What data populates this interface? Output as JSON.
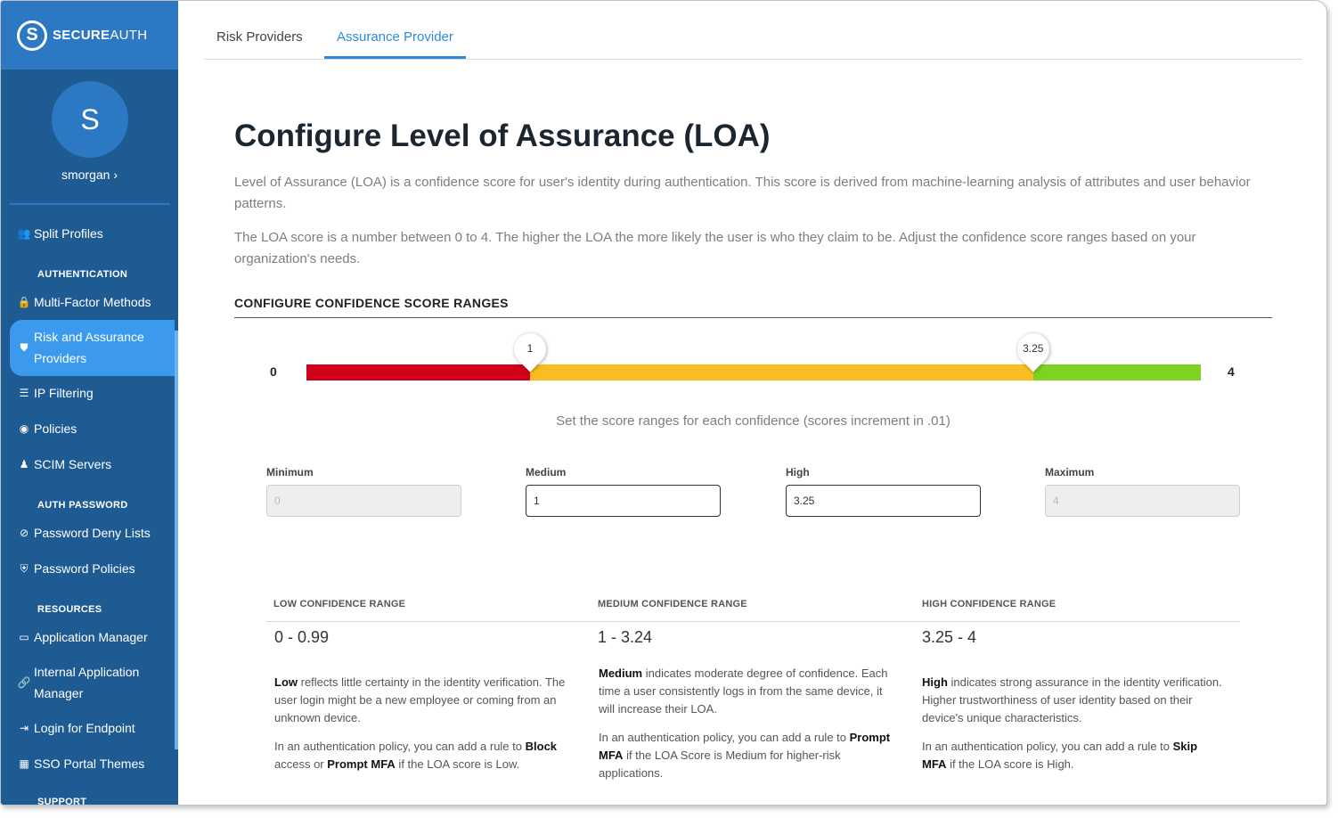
{
  "brand": {
    "logo_letter": "S",
    "name_bold": "SECURE",
    "name_light": "AUTH"
  },
  "user": {
    "initial": "S",
    "name": "smorgan ›"
  },
  "nav": {
    "split_profiles": "Split Profiles",
    "section_auth": "AUTHENTICATION",
    "mfa": "Multi-Factor Methods",
    "risk_line1": "Risk and Assurance",
    "risk_line2": "Providers",
    "ip": "IP Filtering",
    "policies": "Policies",
    "scim": "SCIM Servers",
    "section_password": "AUTH PASSWORD",
    "deny_lists": "Password Deny Lists",
    "pw_policies": "Password Policies",
    "section_resources": "RESOURCES",
    "app_manager": "Application Manager",
    "internal_line1": "Internal Application",
    "internal_line2": "Manager",
    "login_endpoint": "Login for Endpoint",
    "sso_themes": "SSO Portal Themes",
    "section_support": "SUPPORT"
  },
  "tabs": {
    "risk": "Risk Providers",
    "assurance": "Assurance Provider"
  },
  "page": {
    "title": "Configure Level of Assurance (LOA)",
    "desc1": "Level of Assurance (LOA) is a confidence score for user's identity during authentication. This score is derived from machine-learning analysis of attributes and user behavior patterns.",
    "desc2": "The LOA score is a number between 0 to 4. The higher the LOA the more likely the user is who they claim to be. Adjust the confidence score ranges based on your organization's needs.",
    "section_title": "CONFIGURE CONFIDENCE SCORE RANGES",
    "hint": "Set the score ranges for each confidence (scores increment in .01)"
  },
  "slider": {
    "min_label": "0",
    "max_label": "4",
    "medium_marker": "1",
    "high_marker": "3.25",
    "min": 0,
    "max": 4,
    "medium": 1,
    "high": 3.25,
    "colors": {
      "low": "#d0021b",
      "medium": "#f9bd22",
      "high": "#7ed321"
    }
  },
  "fields": {
    "minimum_label": "Minimum",
    "minimum_value": "0",
    "medium_label": "Medium",
    "medium_value": "1",
    "high_label": "High",
    "high_value": "3.25",
    "maximum_label": "Maximum",
    "maximum_value": "4"
  },
  "ranges": {
    "low": {
      "heading": "LOW CONFIDENCE RANGE",
      "value": "0 - 0.99",
      "p1_bold": "Low",
      "p1_rest": " reflects little certainty in the identity verification. The user login might be a new employee or coming from an unknown device.",
      "p2_a": "In an authentication policy, you can add a rule to ",
      "p2_b1": "Block",
      "p2_c": " access or ",
      "p2_b2": "Prompt MFA",
      "p2_d": " if the LOA score is Low."
    },
    "medium": {
      "heading": "MEDIUM CONFIDENCE RANGE",
      "value": "1 - 3.24",
      "p1_bold": "Medium",
      "p1_rest": " indicates moderate degree of confidence. Each time a user consistently logs in from the same device, it will increase their LOA.",
      "p2_a": "In an authentication policy, you can add a rule to ",
      "p2_b1": "Prompt MFA",
      "p2_c": " if the LOA Score is Medium for higher-risk applications."
    },
    "high": {
      "heading": "HIGH CONFIDENCE RANGE",
      "value": "3.25 - 4",
      "p1_bold": "High",
      "p1_rest": " indicates strong assurance in the identity verification. Higher trustworthiness of user identity based on their device's unique characteristics.",
      "p2_a": "In an authentication policy, you can add a rule to ",
      "p2_b1": "Skip MFA",
      "p2_c": " if the LOA score is High."
    }
  }
}
